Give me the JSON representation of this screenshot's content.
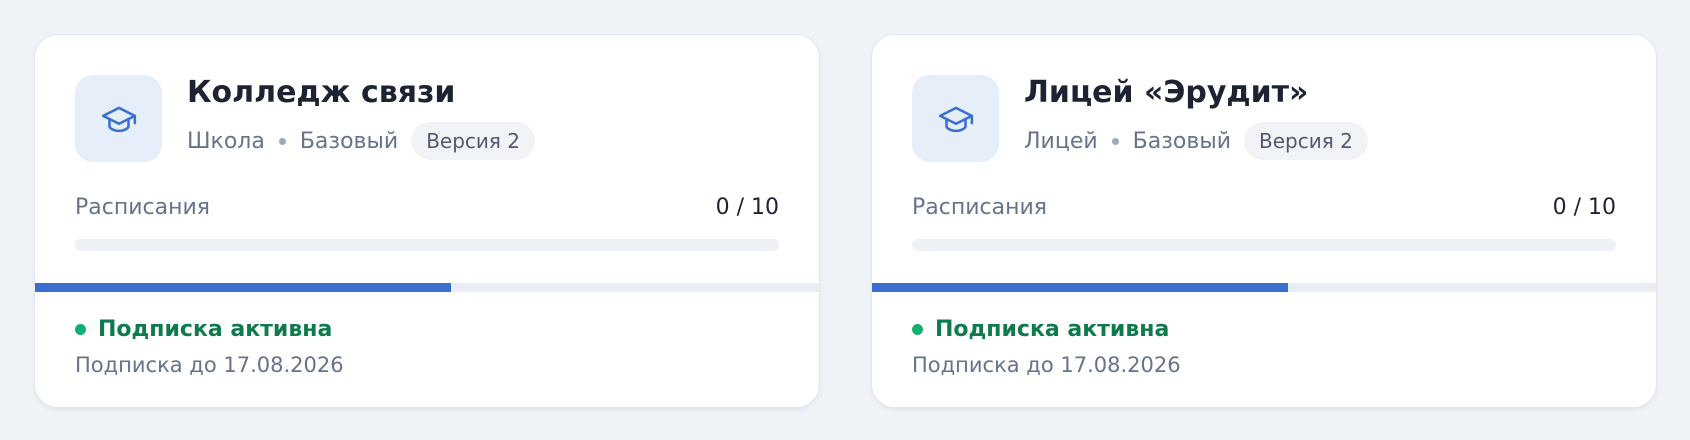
{
  "cards": [
    {
      "icon": "graduation-cap-icon",
      "title": "Колледж связи",
      "type": "Школа",
      "plan": "Базовый",
      "version_badge": "Версия 2",
      "schedules_label": "Расписания",
      "schedules_count": "0 / 10",
      "schedules_used": 0,
      "schedules_limit": 10,
      "subscription_period_progress": 0.53,
      "status": "Подписка активна",
      "subscription_until": "Подписка до 17.08.2026"
    },
    {
      "icon": "graduation-cap-icon",
      "title": "Лицей «Эрудит»",
      "type": "Лицей",
      "plan": "Базовый",
      "version_badge": "Версия 2",
      "schedules_label": "Расписания",
      "schedules_count": "0 / 10",
      "schedules_used": 0,
      "schedules_limit": 10,
      "subscription_period_progress": 0.53,
      "status": "Подписка активна",
      "subscription_until": "Подписка до 17.08.2026"
    }
  ],
  "colors": {
    "accent": "#3a6fd0",
    "status_active": "#10b072",
    "status_text": "#0f7a4c"
  }
}
